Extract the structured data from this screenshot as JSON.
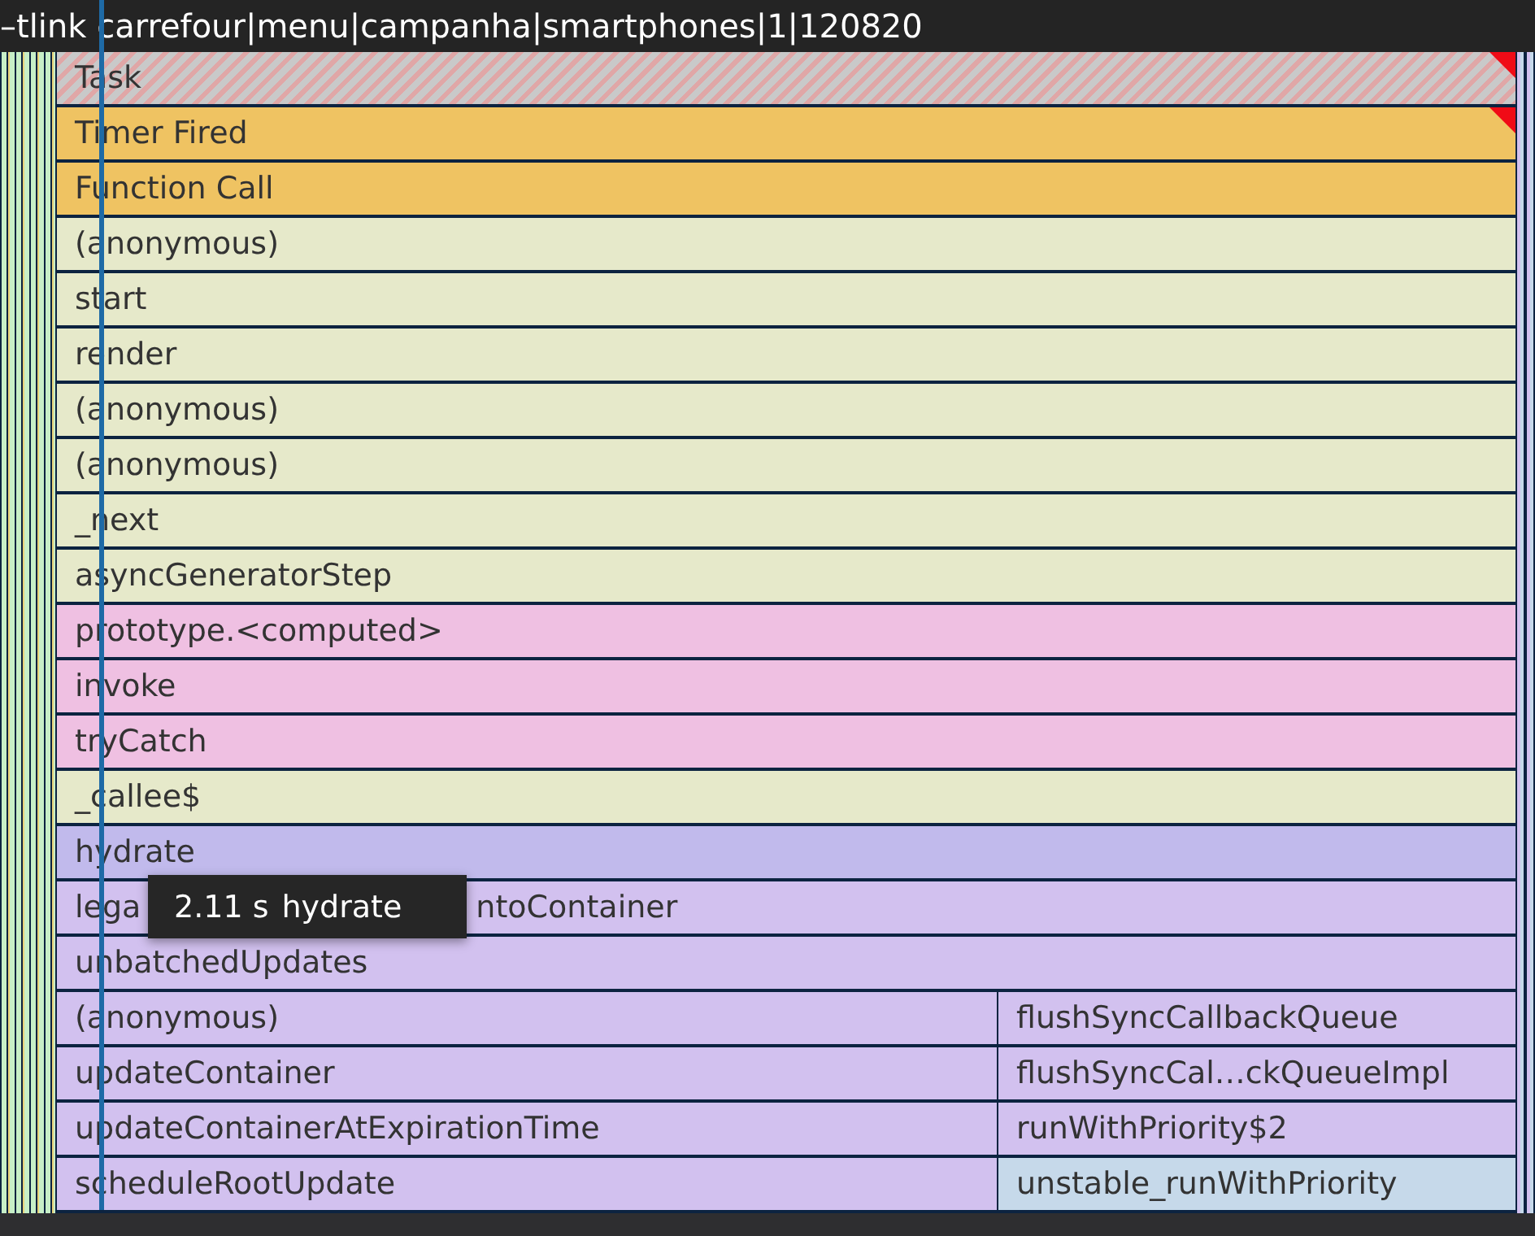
{
  "title_bar": {
    "text": "–tlink carrefour|menu|campanha|smartphones|1|120820"
  },
  "rows": [
    {
      "segments": [
        {
          "kind": "task",
          "label": "Task",
          "warning": true
        }
      ]
    },
    {
      "segments": [
        {
          "kind": "call",
          "label": "Timer Fired",
          "color": "#efc362",
          "warning": true
        }
      ]
    },
    {
      "segments": [
        {
          "kind": "call",
          "label": "Function Call",
          "color": "#efc362",
          "warning": false
        }
      ]
    },
    {
      "segments": [
        {
          "kind": "call",
          "label": "(anonymous)",
          "color": "#e6e9ca",
          "warning": false
        }
      ]
    },
    {
      "segments": [
        {
          "kind": "call",
          "label": "start",
          "color": "#e6e9ca",
          "warning": false
        }
      ]
    },
    {
      "segments": [
        {
          "kind": "call",
          "label": "render",
          "color": "#e6e9ca",
          "warning": false
        }
      ]
    },
    {
      "segments": [
        {
          "kind": "call",
          "label": "(anonymous)",
          "color": "#e6e9ca",
          "warning": false
        }
      ]
    },
    {
      "segments": [
        {
          "kind": "call",
          "label": "(anonymous)",
          "color": "#e6e9ca",
          "warning": false
        }
      ]
    },
    {
      "segments": [
        {
          "kind": "call",
          "label": "_next",
          "color": "#e6e9ca",
          "warning": false
        }
      ]
    },
    {
      "segments": [
        {
          "kind": "call",
          "label": "asyncGeneratorStep",
          "color": "#e6e9ca",
          "warning": false
        }
      ]
    },
    {
      "segments": [
        {
          "kind": "call",
          "label": "prototype.<computed>",
          "color": "#efc0e2",
          "warning": false
        }
      ]
    },
    {
      "segments": [
        {
          "kind": "call",
          "label": "invoke",
          "color": "#efc0e2",
          "warning": false
        }
      ]
    },
    {
      "segments": [
        {
          "kind": "call",
          "label": "tryCatch",
          "color": "#efc0e2",
          "warning": false
        }
      ]
    },
    {
      "segments": [
        {
          "kind": "call",
          "label": "_callee$",
          "color": "#e6e9ca",
          "warning": false
        }
      ]
    },
    {
      "segments": [
        {
          "kind": "call",
          "label": "hydrate",
          "color": "#c1baec",
          "warning": false
        }
      ]
    },
    {
      "segments": [
        {
          "kind": "covered",
          "label_left": "lega",
          "label": "ntoContainer",
          "color": "#d2c1ef",
          "warning": false
        }
      ]
    },
    {
      "segments": [
        {
          "kind": "call",
          "label": "unbatchedUpdates",
          "color": "#d2c1ef",
          "warning": false
        }
      ]
    },
    {
      "segments": [
        {
          "kind": "call",
          "label": "(anonymous)",
          "color": "#d2c1ef",
          "warning": false
        },
        {
          "kind": "call",
          "label": "flushSyncCallbackQueue",
          "color": "#d2c1ef",
          "warning": false
        }
      ]
    },
    {
      "segments": [
        {
          "kind": "call",
          "label": "updateContainer",
          "color": "#d2c1ef",
          "warning": false
        },
        {
          "kind": "call",
          "label": "flushSyncCal…ckQueueImpl",
          "color": "#d2c1ef",
          "warning": false
        }
      ]
    },
    {
      "segments": [
        {
          "kind": "call",
          "label": "updateContainerAtExpirationTime",
          "color": "#d2c1ef",
          "warning": false
        },
        {
          "kind": "call",
          "label": "runWithPriority$2",
          "color": "#d2c1ef",
          "warning": false
        }
      ]
    },
    {
      "segments": [
        {
          "kind": "call",
          "label": "scheduleRootUpdate",
          "color": "#d2c1ef",
          "warning": false
        },
        {
          "kind": "call",
          "label": "unstable_runWithPriority",
          "color": "#c6d9ea",
          "warning": false
        }
      ]
    }
  ],
  "tooltip": {
    "duration": "2.11 s",
    "name": "hydrate"
  }
}
